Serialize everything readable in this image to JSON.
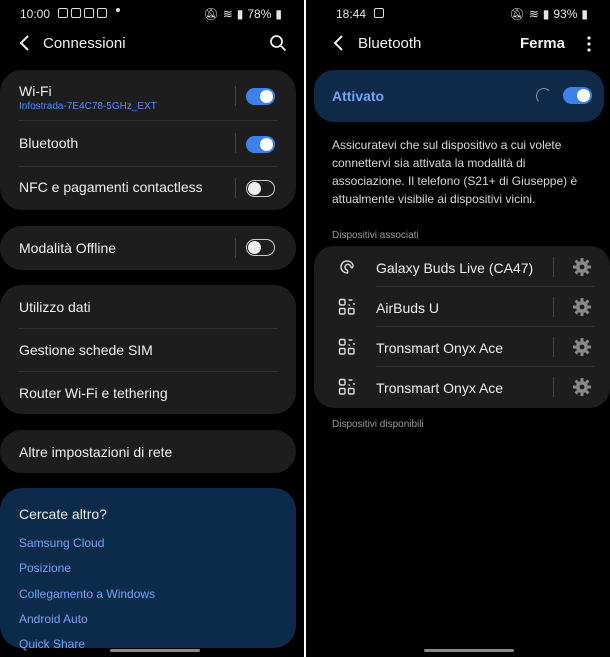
{
  "left": {
    "status": {
      "time": "10:00",
      "battery": "78%"
    },
    "title": "Connessioni",
    "groups": [
      {
        "items": [
          {
            "label": "Wi-Fi",
            "sub": "Infostrada-7E4C78-5GHz_EXT",
            "toggle": "on"
          },
          {
            "label": "Bluetooth",
            "toggle": "on"
          },
          {
            "label": "NFC e pagamenti contactless",
            "toggle": "off"
          }
        ]
      },
      {
        "items": [
          {
            "label": "Modalità Offline",
            "toggle": "off"
          }
        ]
      },
      {
        "items": [
          {
            "label": "Utilizzo dati"
          },
          {
            "label": "Gestione schede SIM"
          },
          {
            "label": "Router Wi-Fi e tethering"
          }
        ]
      },
      {
        "items": [
          {
            "label": "Altre impostazioni di rete"
          }
        ]
      }
    ],
    "more": {
      "heading": "Cercate altro?",
      "links": [
        "Samsung Cloud",
        "Posizione",
        "Collegamento a Windows",
        "Android Auto",
        "Quick Share"
      ]
    }
  },
  "right": {
    "status": {
      "time": "18:44",
      "battery": "93%"
    },
    "title": "Bluetooth",
    "stop": "Ferma",
    "activated": "Attivato",
    "description": "Assicuratevi che sul dispositivo a cui volete connettervi sia attivata la modalità di associazione. Il telefono (S21+ di Giuseppe) è attualmente visibile ai dispositivi vicini.",
    "paired_header": "Dispositivi associati",
    "paired": [
      {
        "name": "Galaxy Buds Live (CA47)",
        "icon": "earbuds-icon"
      },
      {
        "name": "AirBuds U",
        "icon": "generic-device-icon"
      },
      {
        "name": "Tronsmart Onyx Ace",
        "icon": "generic-device-icon"
      },
      {
        "name": "Tronsmart Onyx Ace",
        "icon": "generic-device-icon"
      }
    ],
    "available_header": "Dispositivi disponibili"
  },
  "colors": {
    "accent": "#3c82ef",
    "link": "#6ea6f7",
    "card": "#1d1d1d",
    "blue_card": "#0c2a4a"
  }
}
